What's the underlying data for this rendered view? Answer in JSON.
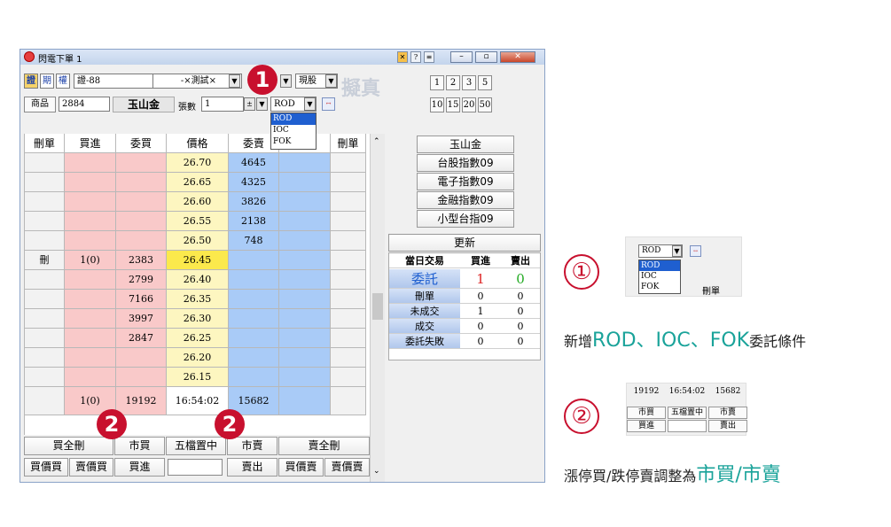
{
  "window": {
    "title": "閃電下單 1",
    "tab_zheng": "證",
    "tab_qi": "期",
    "tab_quan": "權",
    "account": "證-88",
    "account_name": "-×測試×",
    "market_type": "現股",
    "watermark": "擬真",
    "product_label": "商品",
    "product_code": "2884",
    "product_name": "玉山金",
    "qty_label": "張數",
    "qty_value": "1",
    "order_cond": "ROD",
    "order_cond_options": [
      "ROD",
      "IOC",
      "FOK"
    ],
    "qty_presets_row1": [
      "1",
      "2",
      "3",
      "5"
    ],
    "qty_presets_row2": [
      "10",
      "15",
      "20",
      "50"
    ]
  },
  "grid": {
    "headers": [
      "刪單",
      "買進",
      "委買",
      "價格",
      "委賣",
      "賣出",
      "刪單"
    ],
    "rows": [
      {
        "del": "",
        "buy": "",
        "bid": "",
        "price": "26.70",
        "ask": "4645",
        "sell": "",
        "del2": ""
      },
      {
        "del": "",
        "buy": "",
        "bid": "",
        "price": "26.65",
        "ask": "4325",
        "sell": "",
        "del2": ""
      },
      {
        "del": "",
        "buy": "",
        "bid": "",
        "price": "26.60",
        "ask": "3826",
        "sell": "",
        "del2": ""
      },
      {
        "del": "",
        "buy": "",
        "bid": "",
        "price": "26.55",
        "ask": "2138",
        "sell": "",
        "del2": ""
      },
      {
        "del": "",
        "buy": "",
        "bid": "",
        "price": "26.50",
        "ask": "748",
        "sell": "",
        "del2": ""
      },
      {
        "del": "刪",
        "buy": "1(0)",
        "bid": "2383",
        "price": "26.45",
        "ask": "",
        "sell": "",
        "del2": ""
      },
      {
        "del": "",
        "buy": "",
        "bid": "2799",
        "price": "26.40",
        "ask": "",
        "sell": "",
        "del2": ""
      },
      {
        "del": "",
        "buy": "",
        "bid": "7166",
        "price": "26.35",
        "ask": "",
        "sell": "",
        "del2": ""
      },
      {
        "del": "",
        "buy": "",
        "bid": "3997",
        "price": "26.30",
        "ask": "",
        "sell": "",
        "del2": ""
      },
      {
        "del": "",
        "buy": "",
        "bid": "2847",
        "price": "26.25",
        "ask": "",
        "sell": "",
        "del2": ""
      },
      {
        "del": "",
        "buy": "",
        "bid": "",
        "price": "26.20",
        "ask": "",
        "sell": "",
        "del2": ""
      },
      {
        "del": "",
        "buy": "",
        "bid": "",
        "price": "26.15",
        "ask": "",
        "sell": "",
        "del2": ""
      }
    ],
    "total_buy": "1(0)",
    "total_bid": "19192",
    "time": "16:54:02",
    "total_ask": "15682"
  },
  "bottom": {
    "buy_all_delete": "買全刪",
    "market_buy": "市買",
    "five_level_center": "五檔置中",
    "market_sell": "市賣",
    "sell_all_delete": "賣全刪",
    "buy_price_buy": "買價買",
    "sell_price_buy": "賣價買",
    "buy": "買進",
    "sell": "賣出",
    "buy_price_sell": "買價賣",
    "sell_price_sell": "賣價賣"
  },
  "side": {
    "buttons": [
      "玉山金",
      "台股指數09",
      "電子指數09",
      "金融指數09",
      "小型台指09"
    ],
    "refresh": "更新",
    "stats_headers": [
      "當日交易",
      "買進",
      "賣出"
    ],
    "stats_rows": [
      {
        "label": "委託",
        "buy": "1",
        "sell": "0"
      },
      {
        "label": "刪單",
        "buy": "0",
        "sell": "0"
      },
      {
        "label": "未成交",
        "buy": "1",
        "sell": "0"
      },
      {
        "label": "成交",
        "buy": "0",
        "sell": "0"
      },
      {
        "label": "委託失敗",
        "buy": "0",
        "sell": "0"
      }
    ]
  },
  "markers": {
    "one": "1",
    "two": "2"
  },
  "annotation1": {
    "circle": "①",
    "text_pre": "新增",
    "text_hl": "ROD、IOC、FOK",
    "text_post": "委託條件",
    "thumb_options": [
      "ROD",
      "IOC",
      "FOK"
    ],
    "thumb_dd": "ROD",
    "thumb_del": "刪單"
  },
  "annotation2": {
    "circle": "②",
    "text_pre": "漲停買/跌停賣調整為",
    "text_hl": "市買/市賣",
    "thumb_vals": [
      "19192",
      "16:54:02",
      "15682"
    ],
    "thumb_btns": [
      "市買",
      "五檔置中",
      "市賣"
    ],
    "thumb_btns2": [
      "買進",
      "",
      "賣出"
    ]
  },
  "colors": {
    "marker": "#c8102e",
    "accent_teal": "#1aa39a",
    "buy_bg": "#f9c9c9",
    "sell_bg": "#a9cbf7",
    "price_bg": "#fdf6c0"
  }
}
